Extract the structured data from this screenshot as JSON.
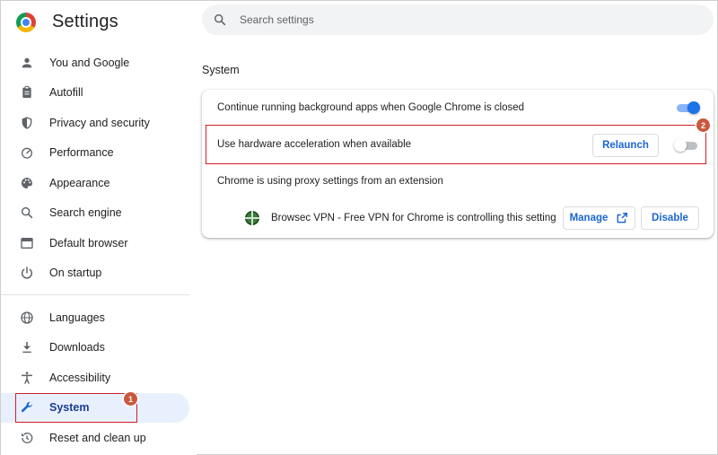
{
  "app": {
    "title": "Settings",
    "logo": "chrome-logo"
  },
  "search": {
    "placeholder": "Search settings",
    "icon": "search-icon"
  },
  "sidebar": {
    "items": [
      {
        "label": "You and Google",
        "icon": "person-icon"
      },
      {
        "label": "Autofill",
        "icon": "clipboard-icon"
      },
      {
        "label": "Privacy and security",
        "icon": "shield-icon"
      },
      {
        "label": "Performance",
        "icon": "speedometer-icon"
      },
      {
        "label": "Appearance",
        "icon": "palette-icon"
      },
      {
        "label": "Search engine",
        "icon": "search-icon"
      },
      {
        "label": "Default browser",
        "icon": "browser-window-icon"
      },
      {
        "label": "On startup",
        "icon": "power-icon"
      }
    ],
    "advanced_items": [
      {
        "label": "Languages",
        "icon": "globe-icon"
      },
      {
        "label": "Downloads",
        "icon": "download-icon"
      },
      {
        "label": "Accessibility",
        "icon": "accessibility-icon"
      },
      {
        "label": "System",
        "icon": "wrench-icon",
        "active": true
      },
      {
        "label": "Reset and clean up",
        "icon": "history-icon"
      }
    ]
  },
  "main": {
    "section_title": "System",
    "rows": {
      "background_apps": {
        "label": "Continue running background apps when Google Chrome is closed",
        "enabled": true
      },
      "hardware_accel": {
        "label": "Use hardware acceleration when available",
        "relaunch_label": "Relaunch",
        "enabled": false
      },
      "proxy": {
        "label": "Chrome is using proxy settings from an extension",
        "extension_text": "Browsec VPN - Free VPN for Chrome is controlling this setting",
        "manage_label": "Manage",
        "disable_label": "Disable"
      }
    }
  },
  "annotations": {
    "badge_1": "1",
    "badge_2": "2",
    "highlight_color": "#d0202a",
    "badge_color": "#c9593d"
  },
  "colors": {
    "accent": "#1a73e8",
    "active_bg": "#e8f0fe"
  }
}
